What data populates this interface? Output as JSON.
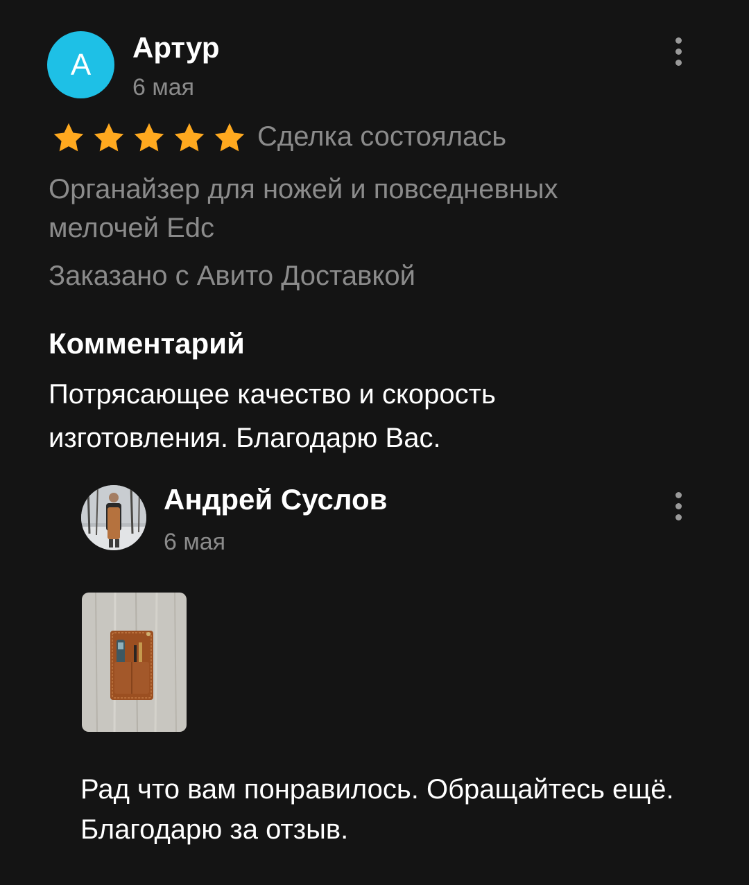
{
  "review": {
    "author_initial": "А",
    "author_name": "Артур",
    "date": "6 мая",
    "rating": 5,
    "deal_status": "Сделка состоялась",
    "item_title": "Органайзер для ножей и повседневных мелочей Edc",
    "delivery": "Заказано с Авито Доставкой",
    "comment_heading": "Комментарий",
    "comment_text": "Потрясающее качество и скорость изготовления. Благодарю Вас."
  },
  "reply": {
    "author_name": "Андрей Суслов",
    "date": "6 мая",
    "text": "Рад что вам понравилось. Обращайтесь ещё. Благодарю за отзыв."
  },
  "colors": {
    "background": "#141414",
    "avatar_accent": "#1ec0e6",
    "star": "#ffa91f",
    "muted_text": "#8b8b8b"
  },
  "icons": {
    "star": "star-icon",
    "more": "more-vertical-icon"
  }
}
